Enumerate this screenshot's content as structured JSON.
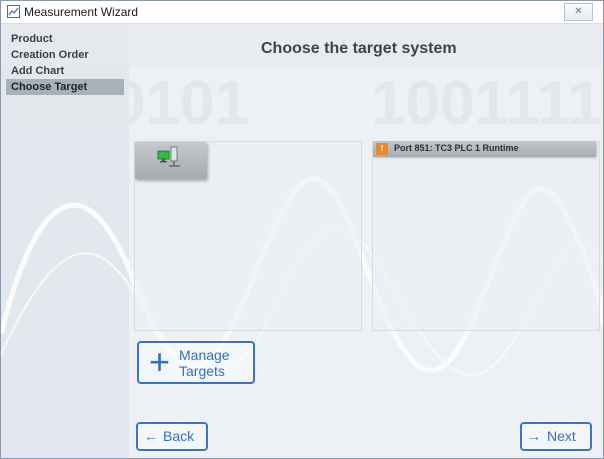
{
  "window": {
    "title": "Measurement Wizard",
    "close_glyph": "✕"
  },
  "sidebar": {
    "items": [
      {
        "label": "Product",
        "active": false
      },
      {
        "label": "Creation Order",
        "active": false
      },
      {
        "label": "Add Chart",
        "active": false
      },
      {
        "label": "Choose Target",
        "active": true
      }
    ]
  },
  "main": {
    "heading": "Choose the target system",
    "local_system_tile": {
      "icon": "computer-network-icon"
    },
    "port": {
      "icon": "plc-runtime-icon",
      "icon_text": "!",
      "label": "Port 851: TC3 PLC 1 Runtime"
    },
    "manage_targets": {
      "icon": "plus-icon",
      "glyph": "+",
      "line1": "Manage",
      "line2": "Targets"
    }
  },
  "footer": {
    "back": {
      "glyph": "←",
      "label": "Back"
    },
    "next": {
      "glyph": "→",
      "label": "Next"
    }
  },
  "colors": {
    "accent": "#3d73c4",
    "port_icon": "#e98a2a",
    "active_nav": "#a8b0b8"
  }
}
